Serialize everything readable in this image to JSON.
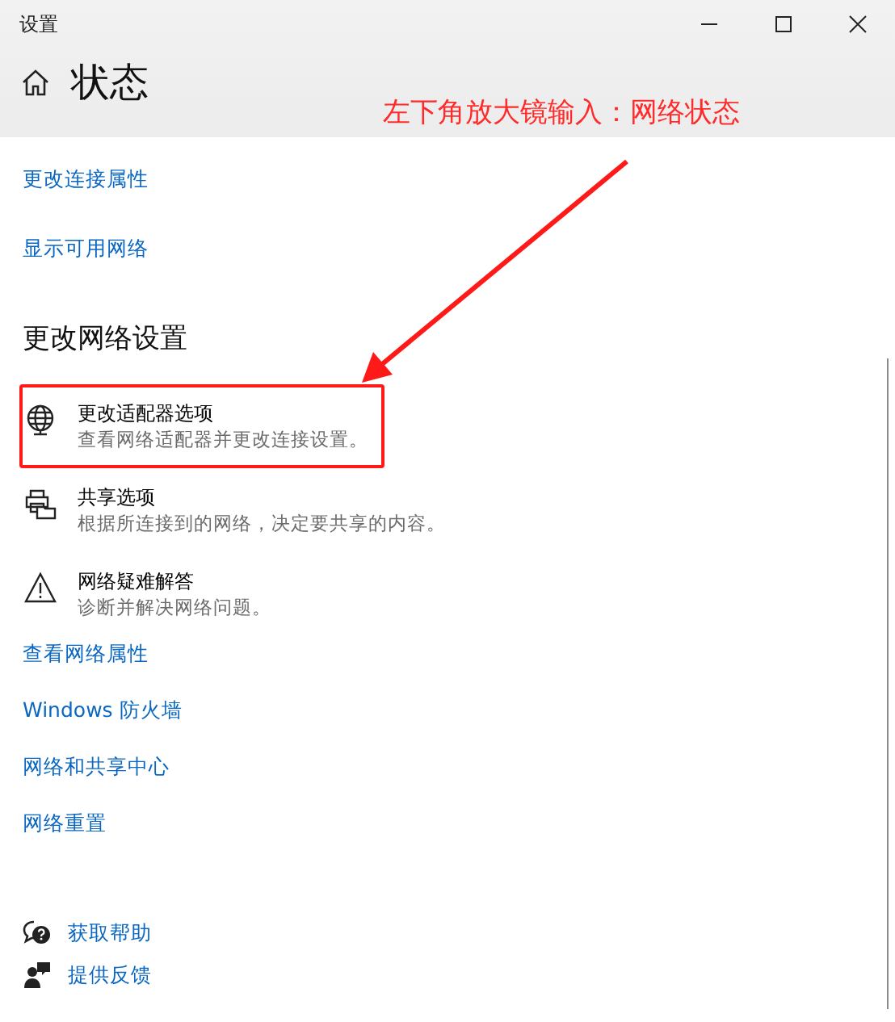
{
  "window": {
    "title": "设置"
  },
  "header": {
    "title": "状态"
  },
  "annotation": {
    "text": "左下角放大镜输入：网络状态"
  },
  "top_links": [
    "更改连接属性",
    "显示可用网络"
  ],
  "section": {
    "title": "更改网络设置",
    "options": [
      {
        "kind": "adapter",
        "title": "更改适配器选项",
        "description": "查看网络适配器并更改连接设置。",
        "highlighted": true
      },
      {
        "kind": "sharing",
        "title": "共享选项",
        "description": "根据所连接到的网络，决定要共享的内容。",
        "highlighted": false
      },
      {
        "kind": "troubleshoot",
        "title": "网络疑难解答",
        "description": "诊断并解决网络问题。",
        "highlighted": false
      }
    ]
  },
  "links": [
    "查看网络属性",
    "Windows 防火墙",
    "网络和共享中心",
    "网络重置"
  ],
  "help": [
    {
      "kind": "help",
      "label": "获取帮助"
    },
    {
      "kind": "feedback",
      "label": "提供反馈"
    }
  ]
}
